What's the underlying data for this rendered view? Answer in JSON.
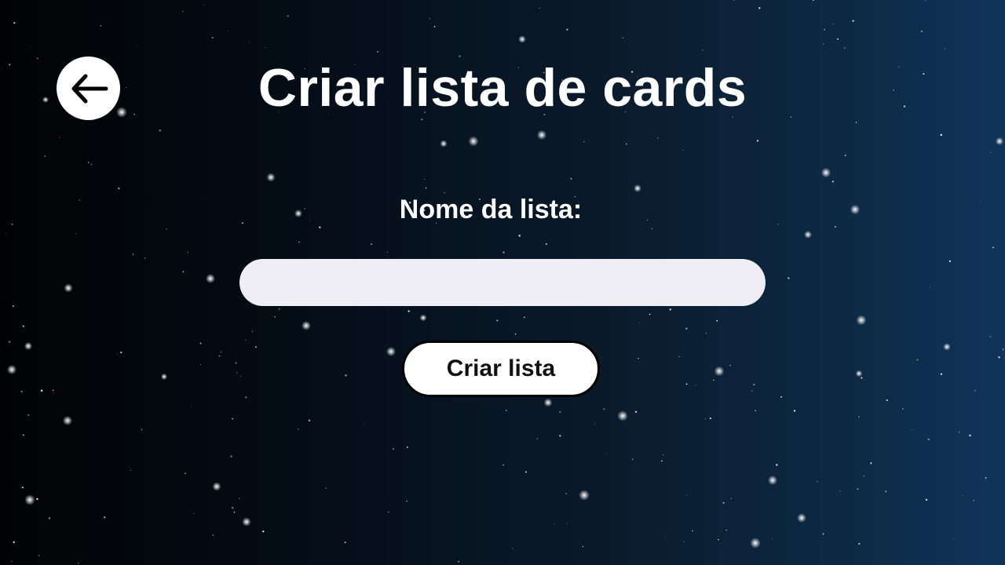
{
  "header": {
    "title": "Criar lista de cards",
    "back_icon": "arrow-left-icon"
  },
  "form": {
    "label": "Nome da lista:",
    "input_value": "",
    "input_placeholder": "",
    "submit_label": "Criar lista"
  },
  "colors": {
    "background_start": "#010203",
    "background_end": "#10345a",
    "input_fill": "#efeef4",
    "button_fill": "#ffffff",
    "text": "#ffffff"
  }
}
